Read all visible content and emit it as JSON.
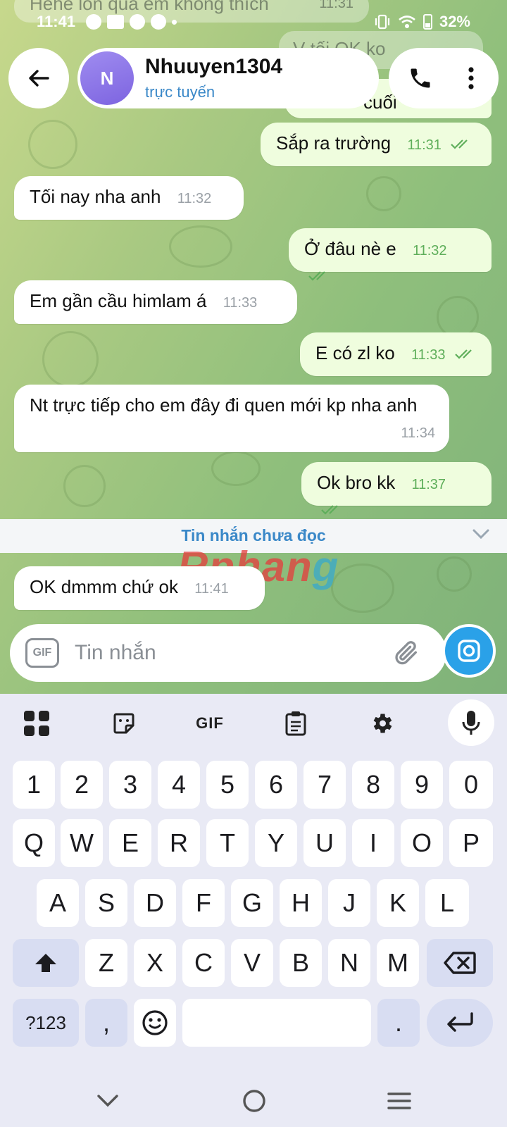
{
  "status_bar": {
    "time": "11:41",
    "battery": "32%"
  },
  "header": {
    "avatar_letter": "N",
    "contact_name": "Nhuuyen1304",
    "contact_status": "trực tuyến"
  },
  "faded": {
    "top_message": "Hehe lồn quá em không thích",
    "top_time": "11:31",
    "second_message": "V tối OK ko",
    "third_message": "cuối"
  },
  "messages": [
    {
      "text": "Sắp ra trường",
      "time": "11:31"
    },
    {
      "text": "Tối nay nha anh",
      "time": "11:32"
    },
    {
      "text": "Ở đâu nè e",
      "time": "11:32"
    },
    {
      "text": "Em gần cầu himlam á",
      "time": "11:33"
    },
    {
      "text": "E có zl ko",
      "time": "11:33"
    },
    {
      "text": "Nt trực tiếp cho em đây đi quen mới kp nha anh",
      "time": "11:34"
    },
    {
      "text": "Ok bro kk",
      "time": "11:37"
    },
    {
      "text": "OK dmmm chứ ok",
      "time": "11:41"
    }
  ],
  "unread_label": "Tin nhắn chưa đọc",
  "watermark": {
    "part1": "Rphan",
    "part2": "g"
  },
  "composer": {
    "gif_label": "GIF",
    "placeholder": "Tin nhắn"
  },
  "keyboard": {
    "toolbar_gif": "GIF",
    "row_numbers": [
      "1",
      "2",
      "3",
      "4",
      "5",
      "6",
      "7",
      "8",
      "9",
      "0"
    ],
    "row1": [
      "Q",
      "W",
      "E",
      "R",
      "T",
      "Y",
      "U",
      "I",
      "O",
      "P"
    ],
    "row2": [
      "A",
      "S",
      "D",
      "F",
      "G",
      "H",
      "J",
      "K",
      "L"
    ],
    "row3": [
      "Z",
      "X",
      "C",
      "V",
      "B",
      "N",
      "M"
    ],
    "symbols_label": "?123",
    "comma": ",",
    "period": "."
  },
  "colors": {
    "accent_blue": "#2aa1e8",
    "link_blue": "#3a88c8",
    "outgoing_bubble": "#effdde",
    "tick_green": "#5eae5a"
  }
}
